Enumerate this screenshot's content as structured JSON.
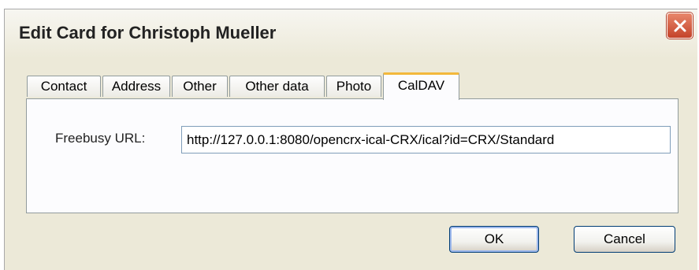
{
  "window": {
    "title": "Edit Card for Christoph Mueller",
    "close_icon": "close-x-icon"
  },
  "tabs": [
    {
      "label": "Contact",
      "active": false
    },
    {
      "label": "Address",
      "active": false
    },
    {
      "label": "Other",
      "active": false
    },
    {
      "label": "Other data",
      "active": false
    },
    {
      "label": "Photo",
      "active": false
    },
    {
      "label": "CalDAV",
      "active": true
    }
  ],
  "caldav": {
    "freebusy_label": "Freebusy URL:",
    "freebusy_value": "http://127.0.0.1:8080/opencrx-ical-CRX/ical?id=CRX/Standard"
  },
  "buttons": {
    "ok_label": "OK",
    "cancel_label": "Cancel"
  },
  "colors": {
    "dialog_bg": "#ece9d8",
    "close_button": "#c4432a",
    "active_tab_accent": "#f3b83c",
    "input_border": "#7f9db9"
  }
}
